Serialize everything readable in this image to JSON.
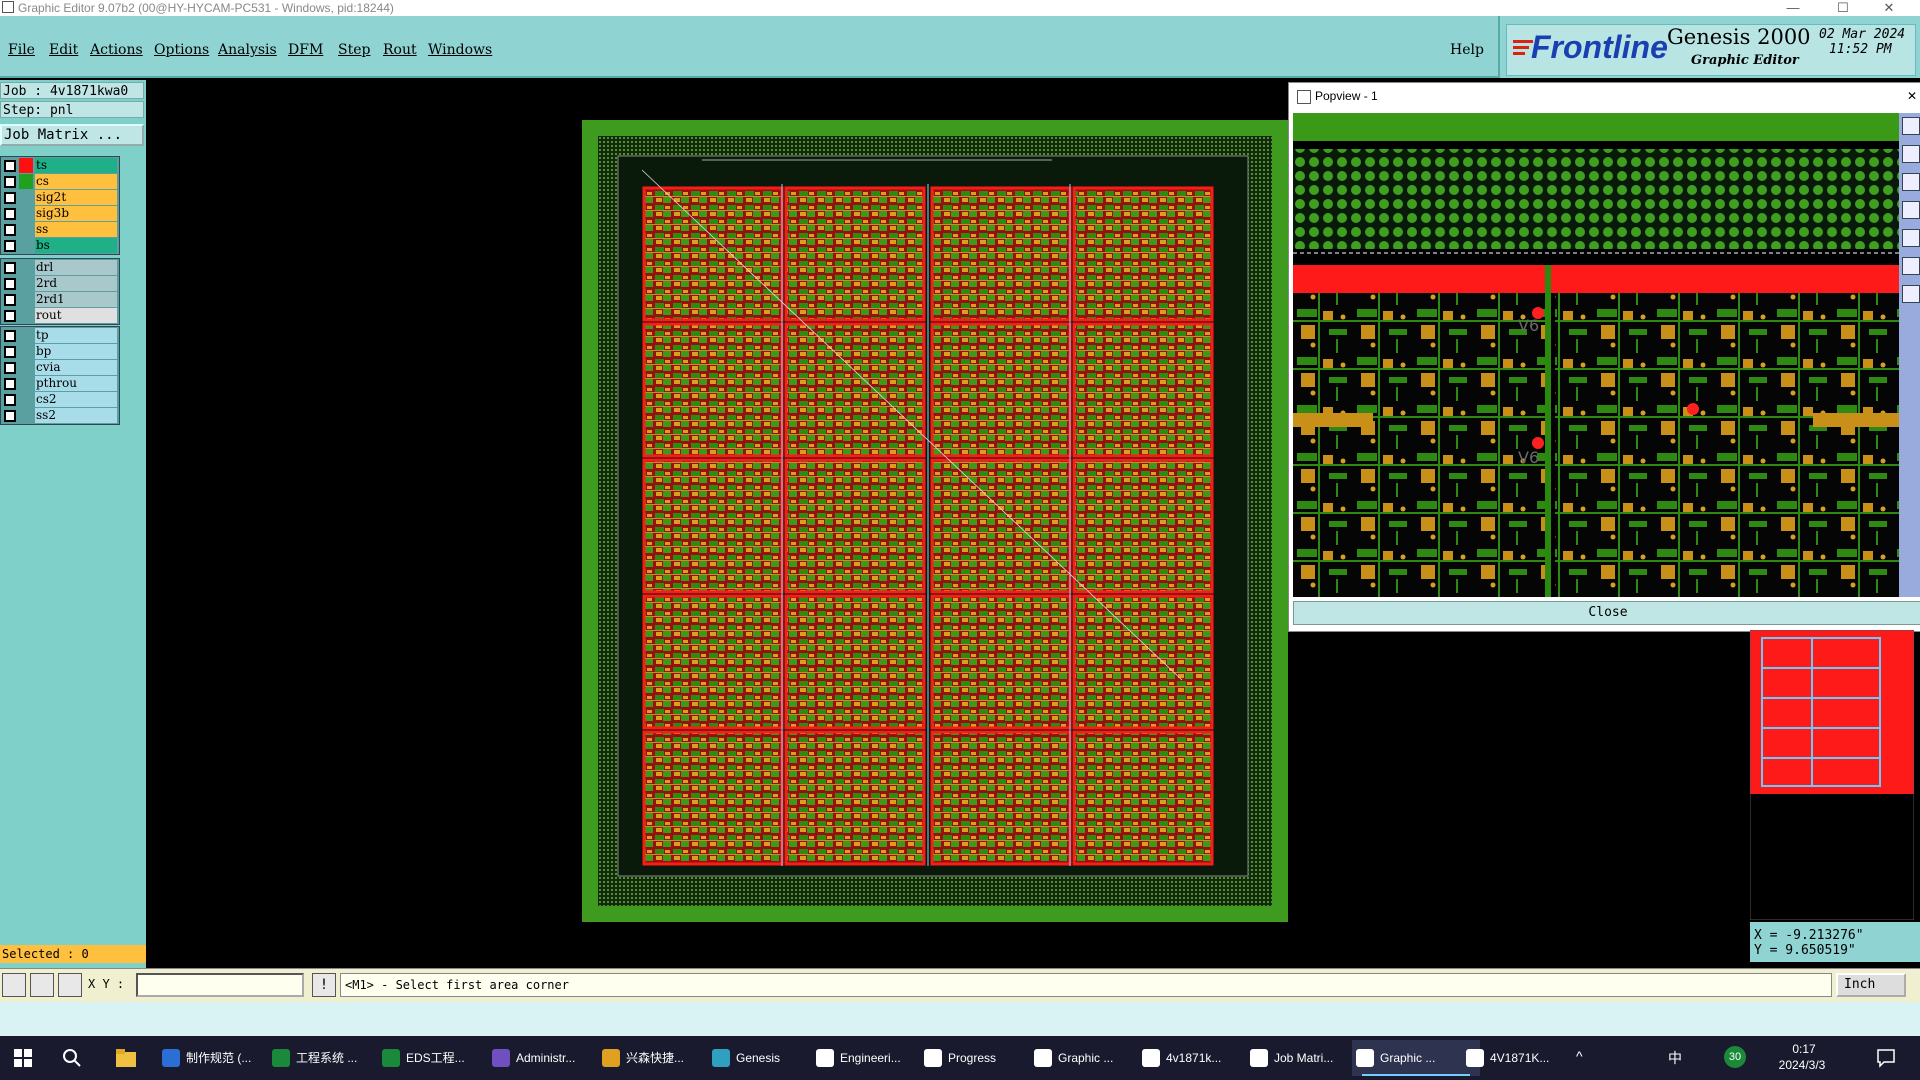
{
  "window": {
    "title": "Graphic Editor 9.07b2 (00@HY-HYCAM-PC531 - Windows, pid:18244)",
    "minimize": "—",
    "maximize": "☐",
    "close": "✕"
  },
  "menu": {
    "items": [
      "File",
      "Edit",
      "Actions",
      "Options",
      "Analysis",
      "DFM",
      "Step",
      "Rout",
      "Windows"
    ],
    "help": "Help"
  },
  "brand": {
    "logo": "Frontline",
    "product": "Genesis 2000",
    "subtitle": "Graphic Editor",
    "date": "02 Mar 2024",
    "time": "11:52 PM"
  },
  "job": {
    "job_line": "Job : 4v1871kwa0",
    "step_line": "Step: pnl",
    "matrix_button": "Job Matrix ..."
  },
  "layers": {
    "group1": [
      {
        "name": "ts",
        "color": "#ff1010",
        "bg": "#20b088"
      },
      {
        "name": "cs",
        "color": "#20a020",
        "bg": "#ffc040"
      },
      {
        "name": "sig2t",
        "color": "",
        "bg": "#ffc040"
      },
      {
        "name": "sig3b",
        "color": "",
        "bg": "#ffc040"
      },
      {
        "name": "ss",
        "color": "",
        "bg": "#ffc040"
      },
      {
        "name": "bs",
        "color": "",
        "bg": "#20b088"
      }
    ],
    "group2": [
      {
        "name": "drl",
        "color": "",
        "bg": "#a8c8cc"
      },
      {
        "name": "2rd",
        "color": "",
        "bg": "#a8c8cc"
      },
      {
        "name": "2rd1",
        "color": "",
        "bg": "#a8c8cc"
      },
      {
        "name": "rout",
        "color": "",
        "bg": "#e0e0e0"
      }
    ],
    "group3": [
      {
        "name": "tp",
        "color": "",
        "bg": "#a8dce8"
      },
      {
        "name": "bp",
        "color": "",
        "bg": "#a8dce8"
      },
      {
        "name": "cvia",
        "color": "",
        "bg": "#a8dce8"
      },
      {
        "name": "pthrou",
        "color": "",
        "bg": "#a8dce8"
      },
      {
        "name": "cs2",
        "color": "",
        "bg": "#a8dce8"
      },
      {
        "name": "ss2",
        "color": "",
        "bg": "#a8dce8"
      }
    ]
  },
  "selected": "Selected : 0",
  "popview": {
    "title": "Popview - 1",
    "close_x": "✕",
    "close_button": "Close",
    "labels": [
      "V6",
      "V6"
    ]
  },
  "coords": {
    "x": "X = -9.213276\"",
    "y": "Y = 9.650519\""
  },
  "status": {
    "xy_label": "X Y :",
    "xy_value": "",
    "info_icon": "!",
    "prompt": "<M1> - Select first area corner",
    "units": "Inch"
  },
  "taskbar": {
    "items": [
      {
        "label": "制作规范 (...",
        "color": "#2b6fd6"
      },
      {
        "label": "工程系统 ...",
        "color": "#1a8a3a"
      },
      {
        "label": "EDS工程...",
        "color": "#1a8a3a"
      },
      {
        "label": "Administr...",
        "color": "#7050c0"
      },
      {
        "label": "兴森快捷...",
        "color": "#e0a020"
      },
      {
        "label": "Genesis",
        "color": "#30a0c0"
      },
      {
        "label": "Engineeri...",
        "color": "#ffffff"
      },
      {
        "label": "Progress",
        "color": "#ffffff"
      },
      {
        "label": "Graphic ...",
        "color": "#ffffff"
      },
      {
        "label": "4v1871k...",
        "color": "#ffffff"
      },
      {
        "label": "Job Matri...",
        "color": "#ffffff"
      },
      {
        "label": "Graphic ...",
        "color": "#ffffff"
      },
      {
        "label": "4V1871K...",
        "color": "#ffffff"
      }
    ],
    "tray_ime": "中",
    "tray_badge": "30",
    "clock_time": "0:17",
    "clock_date": "2024/3/3"
  },
  "icons": [
    "windows-start-icon",
    "search-icon",
    "file-explorer-icon",
    "notification-icon",
    "ime-icon",
    "volume-icon",
    "network-icon"
  ]
}
